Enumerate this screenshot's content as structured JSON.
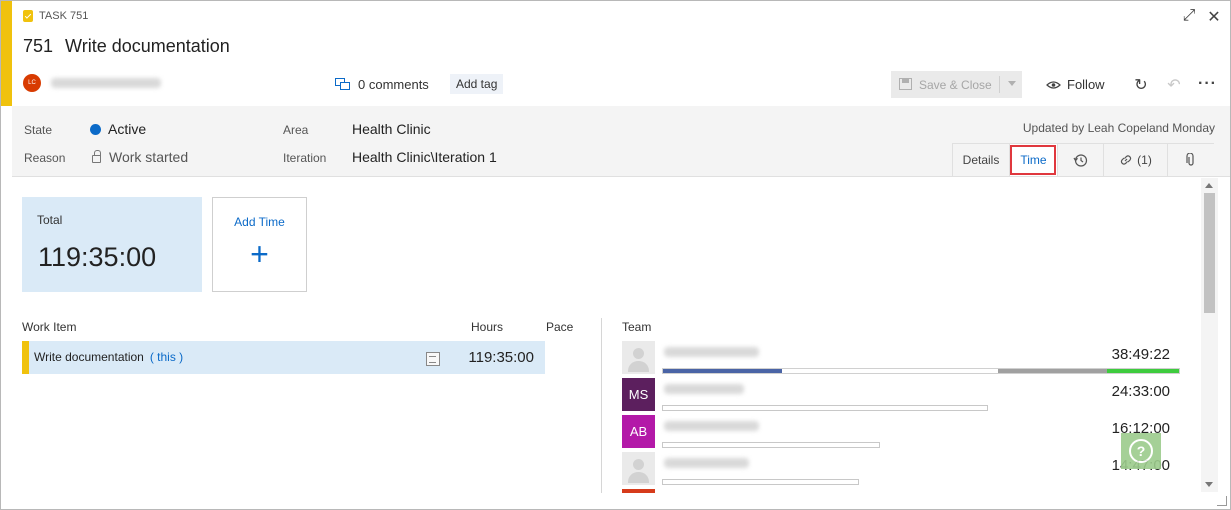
{
  "colors": {
    "accent": "#f0c20d",
    "link": "#0b6ac8",
    "state_active": "#0b6ac8",
    "total_card_bg": "#daeaf7",
    "avatar_ms": "#5c1f5e",
    "avatar_ab": "#b319a8",
    "avatar_orange": "#d63b1b",
    "assignee_avatar": "#d83b01",
    "bar_blue": "#4a64a6",
    "bar_gray": "#a0a0a0",
    "bar_green": "#3ecb3e",
    "task_icon": "#f0c20d"
  },
  "header": {
    "type_label": "TASK 751",
    "id": "751",
    "title": "Write documentation",
    "assignee_initials": "LC",
    "comments_label": "0 comments",
    "add_tag_label": "Add tag",
    "save_label": "Save & Close",
    "follow_label": "Follow",
    "icons": [
      "task-icon",
      "maximize-icon",
      "close-icon",
      "comments-icon",
      "save-icon",
      "eye-icon",
      "refresh-icon",
      "undo-icon",
      "more-icon"
    ]
  },
  "fields": {
    "state_label": "State",
    "state_value": "Active",
    "reason_label": "Reason",
    "reason_value": "Work started",
    "area_label": "Area",
    "area_value": "Health Clinic",
    "iteration_label": "Iteration",
    "iteration_value": "Health Clinic\\Iteration 1",
    "updated_text": "Updated by Leah Copeland Monday"
  },
  "tabs": {
    "details": "Details",
    "time": "Time",
    "links": "(1)",
    "active": "Time"
  },
  "time": {
    "total_label": "Total",
    "total_value": "119:35:00",
    "add_time_label": "Add Time",
    "add_plus": "+",
    "columns": {
      "work_item": "Work Item",
      "hours": "Hours",
      "pace": "Pace",
      "team": "Team"
    },
    "work_items": [
      {
        "name": "Write documentation",
        "link": "( this )",
        "hours": "119:35:00"
      }
    ],
    "team": [
      {
        "initials": "",
        "time": "38:49:22",
        "segments": [
          {
            "color": "#4a64a6",
            "from": 0.0,
            "to": 0.23
          },
          {
            "color": "#a0a0a0",
            "from": 0.65,
            "to": 0.86
          },
          {
            "color": "#3ecb3e",
            "from": 0.86,
            "to": 1.0
          }
        ]
      },
      {
        "initials": "MS",
        "time": "24:33:00",
        "level": 0.63
      },
      {
        "initials": "AB",
        "time": "16:12:00",
        "level": 0.42
      },
      {
        "initials": "",
        "time": "14:47:00",
        "level": 0.38
      }
    ]
  }
}
